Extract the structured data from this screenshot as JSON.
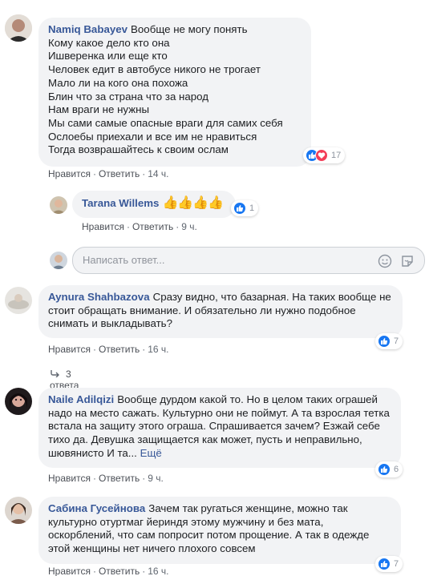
{
  "comments": [
    {
      "author": "Namiq Babayev",
      "lines": [
        "Вообще не могу понять",
        "Кому какое дело кто она",
        "Ишверенка или еще кто",
        "Человек едит в автобусе никого не трогает",
        "Мало ли на кого она похожа",
        "Блин что за страна что за народ",
        "Нам враги не нужны",
        "Мы сами самые опасные враги для самих себя",
        "Ослоебы приехали и все им не нравиться",
        "Тогда возврашайтесь к своим ослам"
      ],
      "reactions": {
        "icons": [
          "like-icon",
          "love-icon"
        ],
        "count": "17"
      },
      "actions": {
        "like": "Нравится",
        "reply": "Ответить",
        "time": "14 ч."
      }
    },
    {
      "author": "Tarana Willems",
      "emoji": "👍👍👍👍",
      "reactions": {
        "icons": [
          "like-icon"
        ],
        "count": "1"
      },
      "actions": {
        "like": "Нравится",
        "reply": "Ответить",
        "time": "9 ч."
      }
    },
    {
      "author": "Aynura Shahbazova",
      "text": "Сразу видно, что базарная. На таких вообще не стоит обращать внимание. И обязательно ли нужно подобное снимать и выкладывать?",
      "reactions": {
        "icons": [
          "like-icon"
        ],
        "count": "7"
      },
      "actions": {
        "like": "Нравится",
        "reply": "Ответить",
        "time": "16 ч."
      },
      "replies_link": "3 ответа"
    },
    {
      "author": "Naile Adilqizi",
      "text": "Вообще дурдом какой то. Но в целом таких ограшей надо на место сажать. Культурно они не поймут. А та взрослая тетка встала на защиту этого ограша. Спрашивается зачем? Езжай себе тихо да. Девушка защищается как может, пусть и неправильно, шювянисто И та...",
      "more": "Ещё",
      "reactions": {
        "icons": [
          "like-icon"
        ],
        "count": "6"
      },
      "actions": {
        "like": "Нравится",
        "reply": "Ответить",
        "time": "9 ч."
      }
    },
    {
      "author": "Сабина Гусейнова",
      "text": "Зачем так ругаться женщине, можно так культурно отуртмаг йериндя этому мужчину и без мата, оскорблений, что сам попросит потом прощение. А так в одежде этой женщины нет ничего плохого совсем",
      "reactions": {
        "icons": [
          "like-icon"
        ],
        "count": "7"
      },
      "actions": {
        "like": "Нравится",
        "reply": "Ответить",
        "time": "16 ч."
      }
    }
  ],
  "reply_input": {
    "placeholder": "Написать ответ..."
  },
  "colors": {
    "author": "#385898",
    "bubble": "#f2f3f5",
    "like": "#1877f2",
    "love": "#f33e58"
  }
}
